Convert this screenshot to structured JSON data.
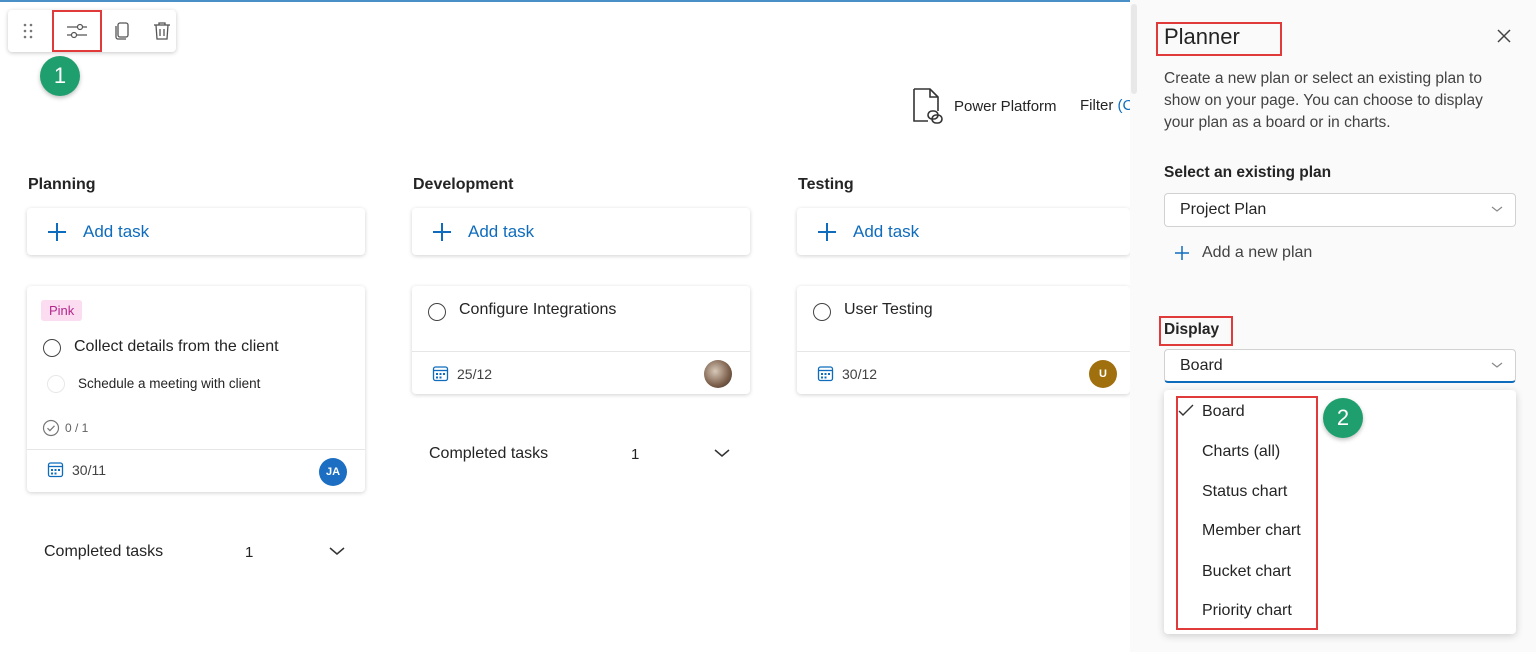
{
  "toolbar": {
    "icons": [
      "drag-handle-icon",
      "settings-sliders-icon",
      "copy-icon",
      "trash-icon"
    ]
  },
  "annotations": {
    "step1": "1",
    "step2": "2"
  },
  "header": {
    "power_platform_label": "Power Platform",
    "filter_label": "Filter",
    "filter_paren": "(C"
  },
  "board": {
    "columns": [
      {
        "title": "Planning",
        "add_task_label": "Add task"
      },
      {
        "title": "Development",
        "add_task_label": "Add task"
      },
      {
        "title": "Testing",
        "add_task_label": "Add task"
      }
    ],
    "planning_card": {
      "label_tag": "Pink",
      "title": "Collect details from the client",
      "checklist_item": "Schedule a meeting with client",
      "checklist_progress": "0 / 1",
      "due": "30/11",
      "assignee_initials": "JA"
    },
    "development_card": {
      "title": "Configure Integrations",
      "due": "25/12"
    },
    "testing_card": {
      "title": "User Testing",
      "due": "30/12",
      "assignee_initials": "U"
    },
    "planning_completed": {
      "label": "Completed tasks",
      "count": "1"
    },
    "development_completed": {
      "label": "Completed tasks",
      "count": "1"
    }
  },
  "panel": {
    "title": "Planner",
    "description": "Create a new plan or select an existing plan to show on your page. You can choose to display your plan as a board or in charts.",
    "select_label": "Select an existing plan",
    "selected_plan": "Project Plan",
    "add_plan_label": "Add a new plan",
    "display_label": "Display",
    "display_value": "Board",
    "display_options": [
      "Board",
      "Charts (all)",
      "Status chart",
      "Member chart",
      "Bucket chart",
      "Priority chart"
    ],
    "selected_option": "Board"
  },
  "colors": {
    "accent": "#0f6cbd",
    "highlight": "#e03a3a",
    "badge": "#1f9e6e",
    "pink_tag_bg": "#fbdcf0",
    "pink_tag_text": "#b4278b",
    "avatar_ja": "#1b6ec2",
    "avatar_u": "#a0700f"
  }
}
